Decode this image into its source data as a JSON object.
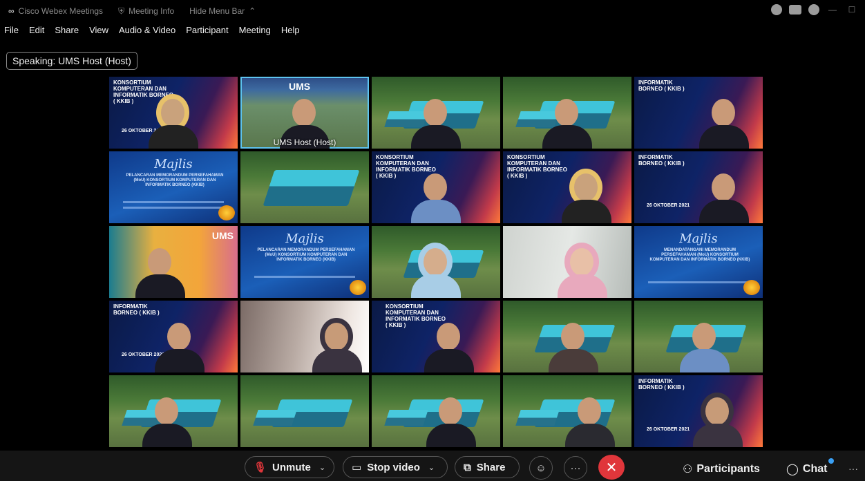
{
  "titlebar": {
    "app_name": "Cisco Webex Meetings",
    "meeting_info": "Meeting Info",
    "hide_menu": "Hide Menu Bar"
  },
  "menu": [
    "File",
    "Edit",
    "Share",
    "View",
    "Audio & Video",
    "Participant",
    "Meeting",
    "Help"
  ],
  "speaking": "Speaking: UMS Host (Host)",
  "tiles": {
    "host_name": "UMS Host (Host)",
    "ums_logo": "UMS",
    "poster_title": "KONSORTIUM KOMPUTERAN DAN INFORMATIK BORNEO ( KKIB )",
    "poster_title_short": "INFORMATIK BORNEO ( KKIB )",
    "poster_date": "26 OKTOBER 2021",
    "invite_title": "Majlis",
    "invite_sub": "PELANCARAN MEMORANDUM PERSEFAHAMAN (MoU) KONSORTIUM KOMPUTERAN DAN INFORMATIK BORNEO (KKIB)",
    "invite_sub_alt": "MENANDATANGANI MEMORANDUM PERSEFAHAMAN (MoU) KONSORTIUM KOMPUTERAN DAN INFORMATIK BORNEO (KKIB)"
  },
  "controls": {
    "unmute": "Unmute",
    "stop_video": "Stop video",
    "share": "Share",
    "participants": "Participants",
    "chat": "Chat"
  },
  "colors": {
    "end_call": "#e0363b",
    "active_border": "#5ec4f0",
    "notification": "#3aa0f5"
  }
}
